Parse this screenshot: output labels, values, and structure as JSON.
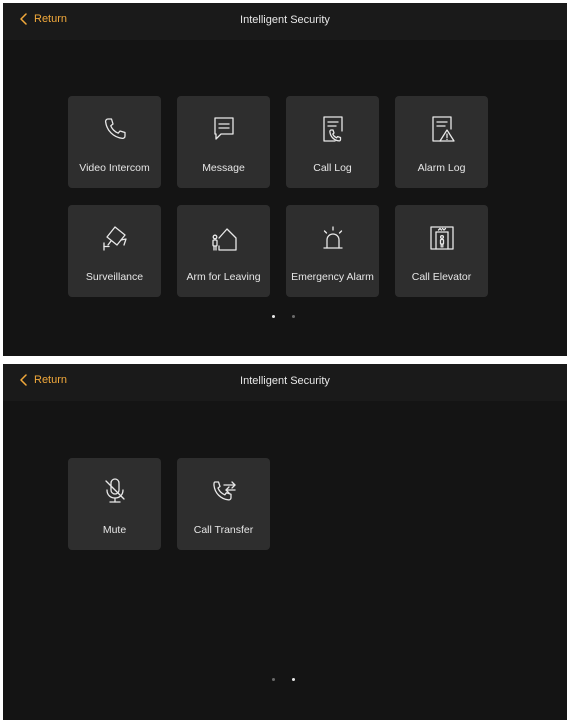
{
  "screens": [
    {
      "back_label": "Return",
      "title": "Intelligent Security",
      "tiles": [
        {
          "label": "Video Intercom",
          "icon": "phone-icon"
        },
        {
          "label": "Message",
          "icon": "message-icon"
        },
        {
          "label": "Call Log",
          "icon": "call-log-icon"
        },
        {
          "label": "Alarm Log",
          "icon": "alarm-log-icon"
        },
        {
          "label": "Surveillance",
          "icon": "camera-icon"
        },
        {
          "label": "Arm for Leaving",
          "icon": "home-leave-icon"
        },
        {
          "label": "Emergency Alarm",
          "icon": "siren-icon"
        },
        {
          "label": "Call Elevator",
          "icon": "elevator-icon"
        }
      ],
      "page_indicator": {
        "pages": 2,
        "current": 1
      }
    },
    {
      "back_label": "Return",
      "title": "Intelligent Security",
      "tiles": [
        {
          "label": "Mute",
          "icon": "mic-off-icon"
        },
        {
          "label": "Call Transfer",
          "icon": "call-transfer-icon"
        }
      ],
      "page_indicator": {
        "pages": 2,
        "current": 2
      }
    }
  ],
  "colors": {
    "accent": "#f2a93b",
    "background": "#141414",
    "tile": "#2e2e2e",
    "text": "#e6e6e6"
  }
}
